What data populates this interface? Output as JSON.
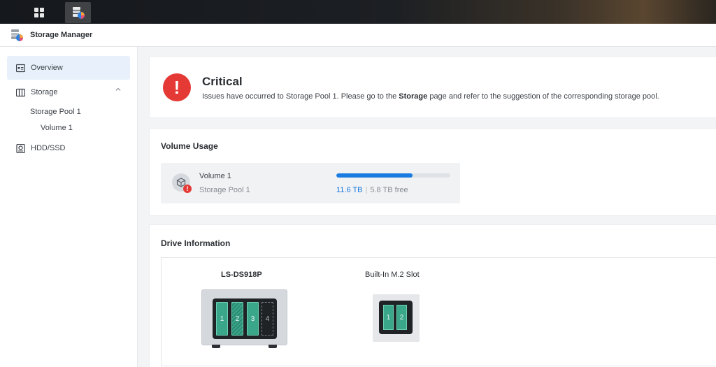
{
  "taskbar": {
    "buttons": [
      {
        "icon": "grid-icon"
      },
      {
        "icon": "storage-manager-icon"
      }
    ]
  },
  "window": {
    "title": "Storage Manager",
    "icon": "storage-manager-icon"
  },
  "sidebar": {
    "items": [
      {
        "label": "Overview",
        "icon": "overview-icon",
        "active": true
      },
      {
        "label": "Storage",
        "icon": "storage-icon",
        "expanded": true
      },
      {
        "label": "Storage Pool 1"
      },
      {
        "label": "Volume 1"
      },
      {
        "label": "HDD/SSD",
        "icon": "hdd-icon"
      }
    ]
  },
  "status": {
    "level": "Critical",
    "message_before": "Issues have occurred to Storage Pool 1. Please go to the ",
    "message_bold": "Storage",
    "message_after": " page and refer to the suggestion of the corresponding storage pool.",
    "color": "#e53935"
  },
  "volume_usage": {
    "title": "Volume Usage",
    "volume": {
      "name": "Volume 1",
      "pool": "Storage Pool 1",
      "used": "11.6 TB",
      "separator": "|",
      "free": "5.8 TB free",
      "usage_fraction": 0.667,
      "accent": "#1a7be0"
    }
  },
  "drive_info": {
    "title": "Drive Information",
    "devices": [
      {
        "name": "LS-DS918P",
        "bays": [
          "1",
          "2",
          "3",
          "4"
        ]
      },
      {
        "name": "Built-In M.2 Slot",
        "slots": [
          "1",
          "2"
        ]
      }
    ]
  }
}
